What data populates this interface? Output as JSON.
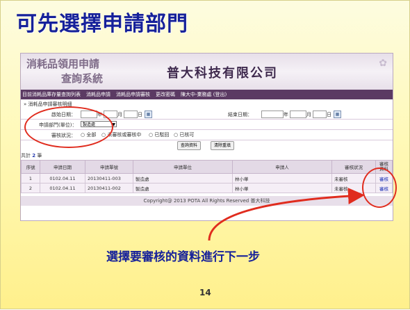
{
  "slide_title": "可先選擇申請部門",
  "app": {
    "system_name_line1": "消耗品領用申請",
    "system_name_line2": "查詢系統",
    "company": "普大科技有限公司"
  },
  "menu": [
    "目前消耗品庫存量查詢列表",
    "消耗品申請",
    "消耗品申請審核",
    "更改密碼",
    "陳大中-業務處 (登出)"
  ],
  "section_title": "» 消耗品申請審核明細",
  "form": {
    "start_label": "啟始日期：",
    "end_label": "結束日期：",
    "year": "年",
    "month": "月",
    "day": "日",
    "dept_label": "申請部門(單位)：",
    "dept_value": "製造處",
    "status_label": "審核狀況：",
    "status_options": [
      "全部",
      "未審核或審核中",
      "已駁回",
      "已核可"
    ],
    "query_button": "查詢資料",
    "clear_button": "清除重填"
  },
  "result_count": {
    "prefix": "共計",
    "count": "2",
    "suffix": "筆"
  },
  "table": {
    "headers": [
      "序號",
      "申請日期",
      "申請單號",
      "申請單位",
      "申請人",
      "審核狀況",
      "審核\n資料"
    ],
    "rows": [
      [
        "1",
        "0102.04.11",
        "20130411-003",
        "製造處",
        "林小華",
        "未審核",
        "審核"
      ],
      [
        "2",
        "0102.04.11",
        "20130411-002",
        "製造處",
        "林小華",
        "未審核",
        "審核"
      ]
    ]
  },
  "footer": "Copyright@ 2013 POTA All Rights Reserved  普大科技",
  "annotation": "選擇要審核的資料進行下一步",
  "page_number": "14"
}
